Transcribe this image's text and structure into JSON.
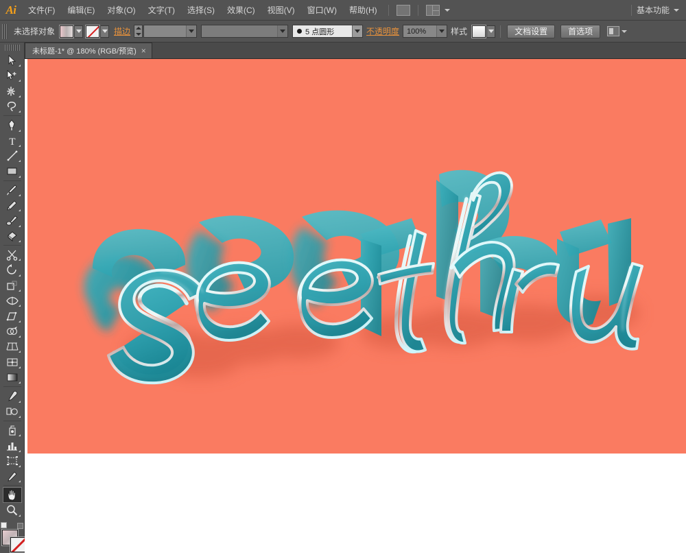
{
  "app": {
    "name": "Adobe Illustrator",
    "logo_text": "Ai"
  },
  "menubar": {
    "items": [
      {
        "label": "文件(F)",
        "name": "menu-file"
      },
      {
        "label": "编辑(E)",
        "name": "menu-edit"
      },
      {
        "label": "对象(O)",
        "name": "menu-object"
      },
      {
        "label": "文字(T)",
        "name": "menu-type"
      },
      {
        "label": "选择(S)",
        "name": "menu-select"
      },
      {
        "label": "效果(C)",
        "name": "menu-effect"
      },
      {
        "label": "视图(V)",
        "name": "menu-view"
      },
      {
        "label": "窗口(W)",
        "name": "menu-window"
      },
      {
        "label": "帮助(H)",
        "name": "menu-help"
      }
    ],
    "bridge_icon": "bridge-icon",
    "arrange_icon": "arrange-documents-icon",
    "workspace": "基本功能"
  },
  "controlbar": {
    "selection_status": "未选择对象",
    "fill_swatch_label": "fill-swatch",
    "stroke_swatch_label": "stroke-swatch",
    "stroke_label": "描边",
    "stroke_weight": "",
    "stroke_profile": "",
    "brush_definition": "5 点圆形",
    "opacity_label": "不透明度",
    "opacity_value": "100%",
    "style_label": "样式",
    "document_setup": "文档设置",
    "preferences": "首选项"
  },
  "tabbar": {
    "tab_title": "未标题-1* @ 180% (RGB/预览)",
    "close_glyph": "×"
  },
  "toolbar": {
    "tools": [
      {
        "name": "selection-tool",
        "label": "选择工具"
      },
      {
        "name": "direct-selection-tool",
        "label": "直接选择工具"
      },
      {
        "name": "magic-wand-tool",
        "label": "魔棒工具"
      },
      {
        "name": "lasso-tool",
        "label": "套索工具"
      },
      {
        "name": "pen-tool",
        "label": "钢笔工具"
      },
      {
        "name": "type-tool",
        "label": "文字工具"
      },
      {
        "name": "line-segment-tool",
        "label": "直线段工具"
      },
      {
        "name": "rectangle-tool",
        "label": "矩形工具"
      },
      {
        "name": "paintbrush-tool",
        "label": "画笔工具"
      },
      {
        "name": "pencil-tool",
        "label": "铅笔工具"
      },
      {
        "name": "blob-brush-tool",
        "label": "斑点画笔工具"
      },
      {
        "name": "eraser-tool",
        "label": "橡皮擦工具"
      },
      {
        "name": "rotate-tool",
        "label": "旋转工具"
      },
      {
        "name": "scale-tool",
        "label": "比例缩放工具"
      },
      {
        "name": "width-tool",
        "label": "宽度工具"
      },
      {
        "name": "free-transform-tool",
        "label": "自由变换工具"
      },
      {
        "name": "shape-builder-tool",
        "label": "形状生成器工具"
      },
      {
        "name": "perspective-grid-tool",
        "label": "透视网格工具"
      },
      {
        "name": "mesh-tool",
        "label": "网格工具"
      },
      {
        "name": "gradient-tool",
        "label": "渐变工具"
      },
      {
        "name": "eyedropper-tool",
        "label": "吸管工具"
      },
      {
        "name": "blend-tool",
        "label": "混合工具"
      },
      {
        "name": "symbol-sprayer-tool",
        "label": "符号喷枪工具"
      },
      {
        "name": "column-graph-tool",
        "label": "柱形图工具"
      },
      {
        "name": "artboard-tool",
        "label": "画板工具"
      },
      {
        "name": "slice-tool",
        "label": "切片工具"
      },
      {
        "name": "hand-tool",
        "label": "抓手工具",
        "selected": true
      },
      {
        "name": "zoom-tool",
        "label": "缩放工具"
      }
    ],
    "fill_name": "fill-color-swatch",
    "stroke_name": "stroke-color-swatch"
  },
  "artwork": {
    "title": "see thru",
    "word_one": "see",
    "word_two": "thru",
    "background_color": "#fa7b61",
    "letter_face_color": "#3aa9b6",
    "letter_face_color_dark": "#1f8e9b",
    "outline_color": "#c9f6fb",
    "extrude_color": "#2e97a4",
    "shadow_color": "#e8664f",
    "highlight_color": "#e0d8d8"
  }
}
